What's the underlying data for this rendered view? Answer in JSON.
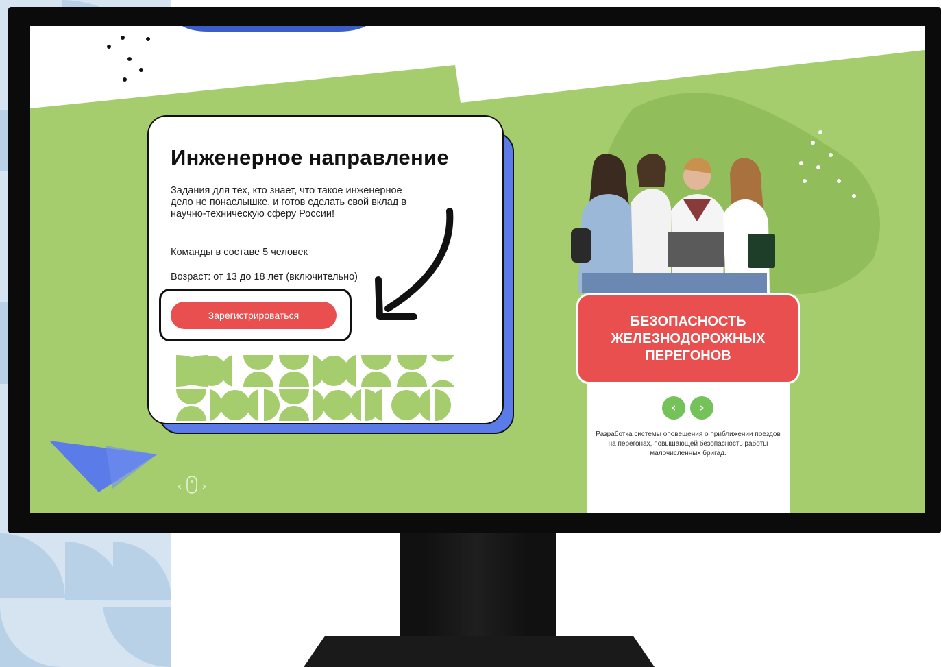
{
  "card": {
    "title": "Инженерное направление",
    "description": "Задания для тех, кто знает, что такое инженерное дело не понаслышке, и готов сделать свой вклад в научно-техническую сферу России!",
    "team": "Команды в составе 5 человек",
    "age": "Возраст: от 13 до 18 лет (включительно)",
    "register_label": "Зарегистрироваться"
  },
  "project": {
    "title": "Безопасность железнодорожных перегонов",
    "description": "Разработка системы оповещения о приближении поездов на перегонах, повышающей безопасность работы малочисленных бригад.",
    "prev_icon": "chevron-left-icon",
    "prev_glyph": "‹",
    "next_icon": "chevron-right-icon",
    "next_glyph": "›"
  },
  "colors": {
    "green": "#a5cd6e",
    "accent_red": "#ea4f4f",
    "card_shadow_blue": "#5b7ce8",
    "nav_green": "#75c15a",
    "monitor": "#0b0b0b",
    "bg_deco_blue": "#c9dced"
  }
}
